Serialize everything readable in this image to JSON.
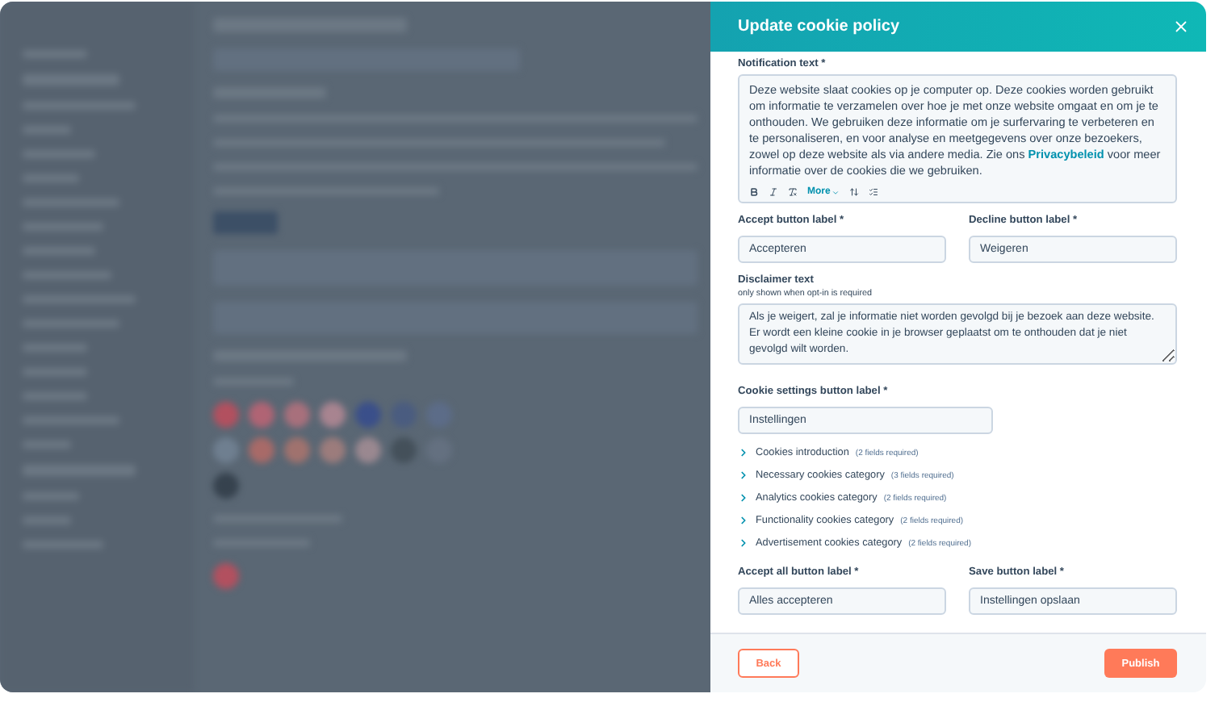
{
  "panel": {
    "title": "Update cookie policy"
  },
  "notification": {
    "label": "Notification text *",
    "text_before": "Deze website slaat cookies op je computer op. Deze cookies worden gebruikt om informatie te verzamelen over hoe je met onze website omgaat en om je te onthouden. We gebruiken deze informatie om je surfervaring te verbeteren en te personaliseren, en voor analyse en meetgegevens over onze bezoekers, zowel op deze website als via andere media. Zie ons ",
    "link": "Privacybeleid",
    "text_after": " voor meer informatie over de cookies die we gebruiken.",
    "more": "More"
  },
  "accept": {
    "label": "Accept button label *",
    "value": "Accepteren"
  },
  "decline": {
    "label": "Decline button label *",
    "value": "Weigeren"
  },
  "disclaimer": {
    "label": "Disclaimer text",
    "hint": "only shown when opt-in is required",
    "value": "Als je weigert, zal je informatie niet worden gevolgd bij je bezoek aan deze website. Er wordt een kleine cookie in je browser geplaatst om te onthouden dat je niet gevolgd wilt worden."
  },
  "settings": {
    "label": "Cookie settings button label *",
    "value": "Instellingen"
  },
  "sections": [
    {
      "label": "Cookies introduction",
      "note": "(2 fields required)",
      "expanded": false
    },
    {
      "label": "Necessary cookies category",
      "note": "(3 fields required)",
      "expanded": false
    },
    {
      "label": "Analytics cookies category",
      "note": "(2 fields required)",
      "expanded": false
    },
    {
      "label": "Functionality cookies category",
      "note": "(2 fields required)",
      "expanded": false
    },
    {
      "label": "Advertisement cookies category",
      "note": "(2 fields required)",
      "expanded": false
    }
  ],
  "accept_all": {
    "label": "Accept all button label *",
    "value": "Alles accepteren"
  },
  "save": {
    "label": "Save button label *",
    "value": "Instellingen opslaan"
  },
  "footer": {
    "back": "Back",
    "publish": "Publish"
  }
}
